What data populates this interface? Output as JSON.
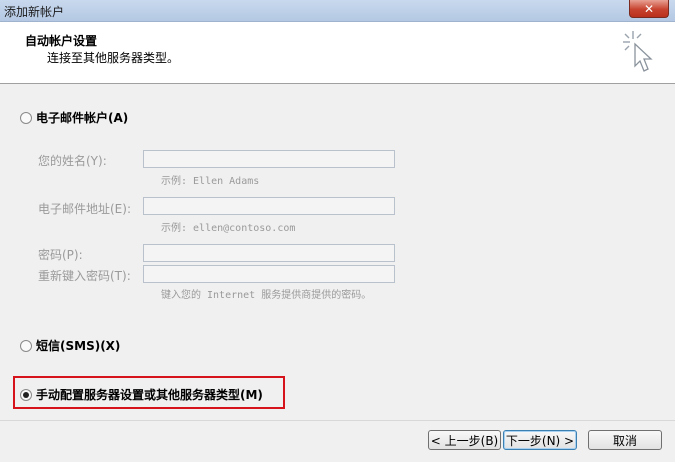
{
  "window": {
    "title": "添加新帐户"
  },
  "header": {
    "title": "自动帐户设置",
    "subtitle": "连接至其他服务器类型。",
    "icon": "wizard-cursor-icon"
  },
  "options": {
    "email": {
      "label": "电子邮件帐户(A)",
      "checked": false
    },
    "sms": {
      "label": "短信(SMS)(X)",
      "checked": false
    },
    "manual": {
      "label": "手动配置服务器设置或其他服务器类型(M)",
      "checked": true
    }
  },
  "form": {
    "name_label": "您的姓名(Y):",
    "name_value": "",
    "name_hint": "示例: Ellen Adams",
    "email_label": "电子邮件地址(E):",
    "email_value": "",
    "email_hint": "示例: ellen@contoso.com",
    "password_label": "密码(P):",
    "password_value": "",
    "retype_label": "重新键入密码(T):",
    "retype_value": "",
    "password_hint": "键入您的 Internet 服务提供商提供的密码。"
  },
  "buttons": {
    "back": "< 上一步(B)",
    "next": "下一步(N) >",
    "cancel": "取消"
  },
  "colors": {
    "highlight": "#d6131b",
    "close": "#c7432f"
  }
}
